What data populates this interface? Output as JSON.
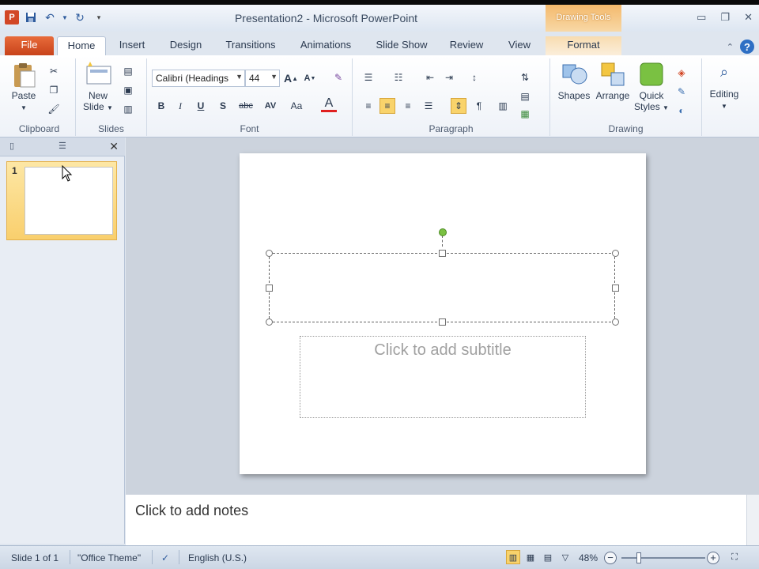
{
  "window": {
    "title": "Presentation2  -  Microsoft PowerPoint",
    "context_tab_group": "Drawing Tools"
  },
  "qat": {
    "app_icon": "P"
  },
  "tabs": [
    "File",
    "Home",
    "Insert",
    "Design",
    "Transitions",
    "Animations",
    "Slide Show",
    "Review",
    "View",
    "Format"
  ],
  "ribbon": {
    "clipboard": {
      "label": "Clipboard",
      "paste": "Paste"
    },
    "slides": {
      "label": "Slides",
      "new_slide_line1": "New",
      "new_slide_line2": "Slide"
    },
    "font": {
      "label": "Font",
      "font_name": "Calibri (Headings",
      "font_size": "44",
      "bold": "B",
      "italic": "I",
      "underline": "U",
      "shadow": "S",
      "strike": "abc",
      "spacing": "AV",
      "case": "Aa",
      "color": "A",
      "grow": "A",
      "shrink": "A"
    },
    "paragraph": {
      "label": "Paragraph"
    },
    "drawing": {
      "label": "Drawing",
      "shapes": "Shapes",
      "arrange": "Arrange",
      "quick_styles_line1": "Quick",
      "quick_styles_line2": "Styles"
    },
    "editing": {
      "label": "Editing"
    }
  },
  "slide_pane": {
    "slide_number": "1"
  },
  "slide": {
    "subtitle_placeholder": "Click to add subtitle"
  },
  "notes": {
    "placeholder": "Click to add notes"
  },
  "status": {
    "slide_info": "Slide 1 of 1",
    "theme": "\"Office Theme\"",
    "language": "English (U.S.)",
    "zoom": "48%"
  }
}
